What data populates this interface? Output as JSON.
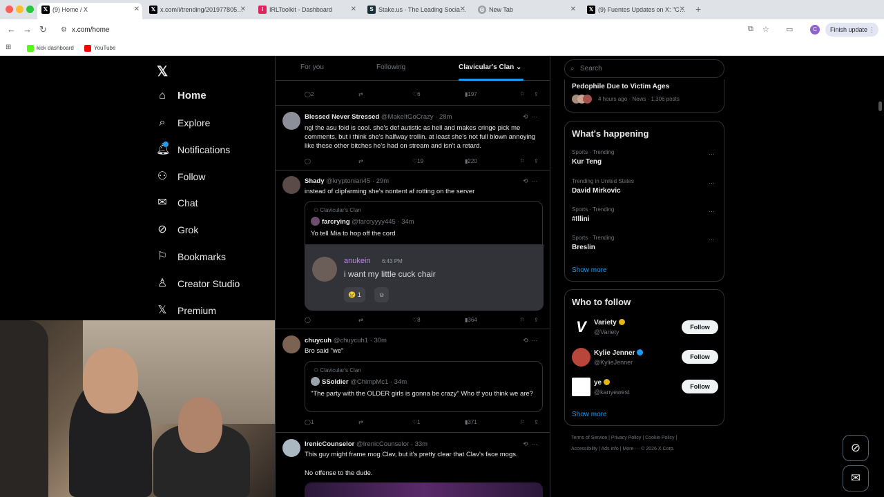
{
  "browser": {
    "tabs": [
      {
        "title": "(9) Home / X",
        "icon": "x-logo"
      },
      {
        "title": "x.com/i/trending/201977805…",
        "icon": "x-logo"
      },
      {
        "title": "IRLToolkit - Dashboard",
        "icon": "irltoolkit-logo"
      },
      {
        "title": "Stake.us - The Leading Socia…",
        "icon": "stake-logo"
      },
      {
        "title": "New Tab",
        "icon": "chrome-logo"
      },
      {
        "title": "(9) Fuentes Updates on X: \"C…",
        "icon": "x-logo"
      }
    ],
    "url": "x.com/home",
    "profile_initial": "C",
    "finish_update": "Finish update",
    "bookmarks": [
      {
        "label": "kick dashboard",
        "color": "#53fc18"
      },
      {
        "label": "YouTube",
        "color": "#ff0000"
      }
    ]
  },
  "nav": {
    "items": [
      {
        "label": "Home",
        "icon": "home-icon"
      },
      {
        "label": "Explore",
        "icon": "search-icon"
      },
      {
        "label": "Notifications",
        "icon": "bell-icon"
      },
      {
        "label": "Follow",
        "icon": "person-add-icon"
      },
      {
        "label": "Chat",
        "icon": "mail-icon"
      },
      {
        "label": "Grok",
        "icon": "grok-icon"
      },
      {
        "label": "Bookmarks",
        "icon": "bookmark-icon"
      },
      {
        "label": "Creator Studio",
        "icon": "creator-studio-icon"
      },
      {
        "label": "Premium",
        "icon": "x-logo-icon"
      }
    ]
  },
  "feed": {
    "tabs": [
      "For you",
      "Following",
      "Clavicular's Clan"
    ],
    "top_actions": {
      "replies": "2",
      "reposts": "",
      "likes": "6",
      "views": "197"
    },
    "posts": [
      {
        "name": "Blessed Never Stressed",
        "handle": "@MakeItGoCrazy · 28m",
        "text": "ngl the asu foid is cool. she's def autistic as hell and makes cringe pick me comments, but i think she's halfway trollin. at least she's not full blown annoying like these other bitches he's had on stream and isn't a retard.",
        "replies": "",
        "likes": "19",
        "views": "220"
      },
      {
        "name": "Shady",
        "handle": "@kryptonian45 · 29m",
        "text": "instead of clipfarming she's nontent af rotting on the server",
        "quote": {
          "community": "Clavicular's Clan",
          "name": "farcrying",
          "handle": "@farcryyyy445 · 34m",
          "text": "Yo tell Mia to hop off the cord",
          "discord": {
            "user": "anukein",
            "time": "6:43 PM",
            "message": "i want my little cuck chair",
            "reaction_count": "1"
          }
        },
        "replies": "",
        "likes": "8",
        "views": "364"
      },
      {
        "name": "chuycuh",
        "handle": "@chuycuh1 · 30m",
        "text": "Bro said \"we\"",
        "quote": {
          "community": "Clavicular's Clan",
          "name": "SSoldier",
          "handle": "@ChimpMc1 · 34m",
          "text": "\"The party with the OLDER girls is gonna be crazy\" Who tf you think we are?"
        },
        "replies": "1",
        "likes": "1",
        "views": "371"
      },
      {
        "name": "IrenicCounselor",
        "handle": "@IrenicCounselor · 33m",
        "text": "This guy might frame mog Clav, but it's pretty clear that Clav's face mogs.",
        "text2": "No offense to the dude."
      }
    ]
  },
  "right": {
    "search_placeholder": "Search",
    "top_card": {
      "title": "Pedophile Due to Victim Ages",
      "meta": "4 hours ago · News · 1,306 posts"
    },
    "whats_happening": {
      "title": "What's happening",
      "trends": [
        {
          "context": "Sports · Trending",
          "name": "Kur Teng"
        },
        {
          "context": "Trending in United States",
          "name": "David Mirkovic"
        },
        {
          "context": "Sports · Trending",
          "name": "#Illini"
        },
        {
          "context": "Sports · Trending",
          "name": "Breslin"
        }
      ],
      "show_more": "Show more"
    },
    "who_to_follow": {
      "title": "Who to follow",
      "accounts": [
        {
          "name": "Variety",
          "handle": "@Variety",
          "badge": "#e2b719"
        },
        {
          "name": "Kylie Jenner",
          "handle": "@KylieJenner",
          "badge": "#1d9bf0"
        },
        {
          "name": "ye",
          "handle": "@kanyewest",
          "badge": "#e2b719"
        }
      ],
      "follow_label": "Follow",
      "show_more": "Show more"
    },
    "footer": {
      "line1": "Terms of Service  |  Privacy Policy  |  Cookie Policy  |",
      "line2": "Accessibility  |  Ads info  |  More ···  © 2026 X Corp."
    }
  }
}
